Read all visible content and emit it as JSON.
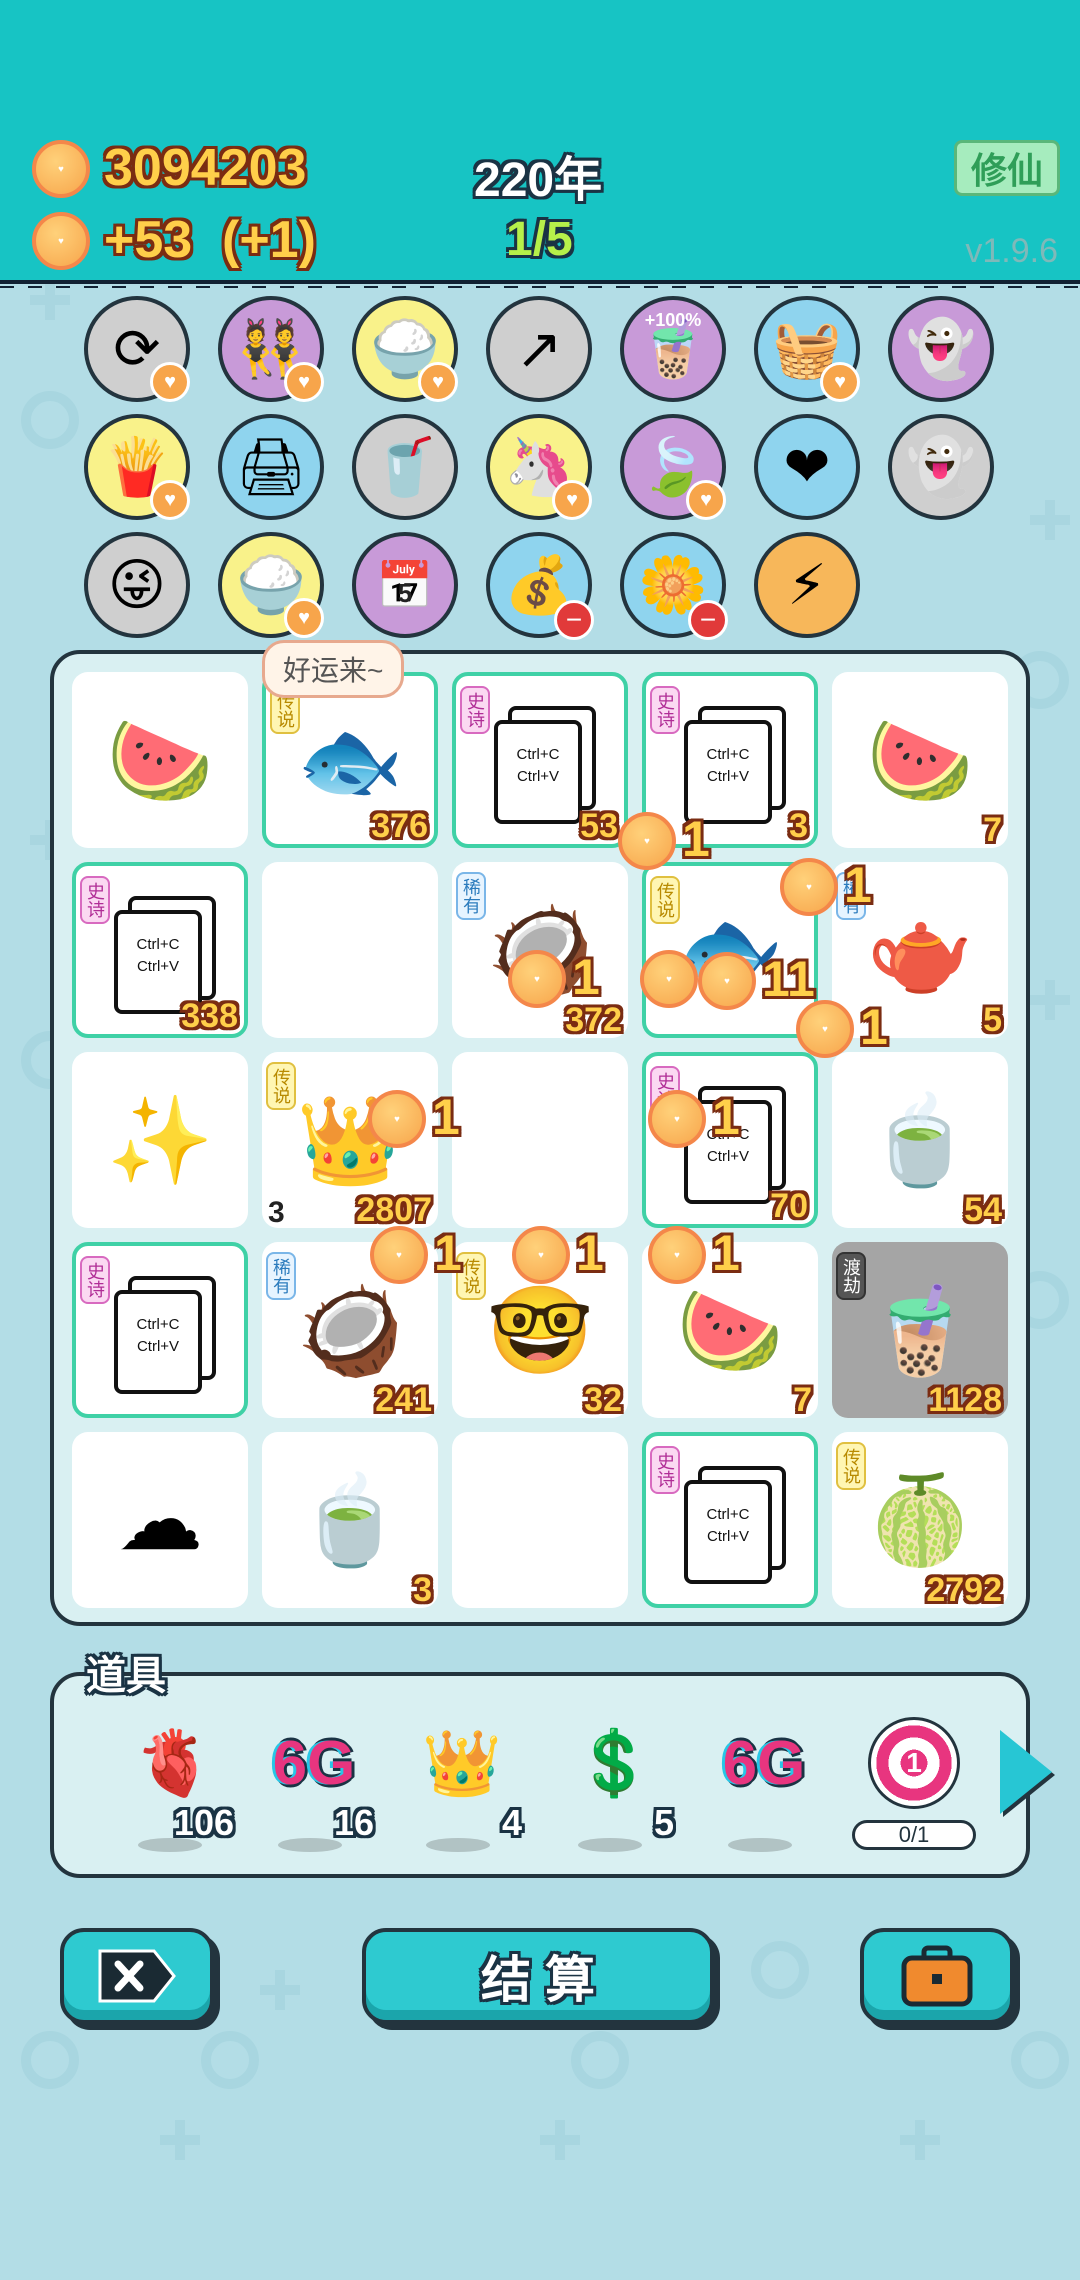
{
  "header": {
    "coins": "3094203",
    "income": "+53",
    "income_bonus": "(+1)",
    "year": "220年",
    "progress": "1/5",
    "cultivate_label": "修仙",
    "version": "v1.9.6"
  },
  "skills": [
    {
      "icon": "refresh-icon",
      "color": "#cfcfcf"
    },
    {
      "icon": "cow-girls-icon",
      "color": "#c89ad8"
    },
    {
      "icon": "rice-bowl-icon",
      "color": "#f9f28a"
    },
    {
      "icon": "upgrade-arrow-icon",
      "color": "#cfcfcf"
    },
    {
      "icon": "milk-tea-icon",
      "color": "#c89ad8",
      "percent": "+100%"
    },
    {
      "icon": "fruit-basket-icon",
      "color": "#8fd4ee"
    },
    {
      "icon": "ghost-bomb-icon",
      "color": "#c89ad8"
    },
    {
      "icon": "fries-icon",
      "color": "#f9f28a"
    },
    {
      "icon": "printer-icon",
      "color": "#8fd4ee"
    },
    {
      "icon": "milk-tea-cup-icon",
      "color": "#cfcfcf"
    },
    {
      "icon": "unicorn-icon",
      "color": "#f9f28a"
    },
    {
      "icon": "leaf-icon",
      "color": "#c89ad8"
    },
    {
      "icon": "heart-cup-icon",
      "color": "#8fd4ee"
    },
    {
      "icon": "ghost-icon",
      "color": "#cfcfcf"
    },
    {
      "icon": "ghost-wink-icon",
      "color": "#cfcfcf"
    },
    {
      "icon": "rice-bowl-icon",
      "color": "#f9f28a"
    },
    {
      "icon": "calendar-icon",
      "color": "#c89ad8",
      "day": "5"
    },
    {
      "icon": "money-bag-icon",
      "color": "#8fd4ee"
    },
    {
      "icon": "flower-pot-icon",
      "color": "#8fd4ee"
    },
    {
      "icon": "lightning-icon",
      "color": "#f7b75a"
    }
  ],
  "board": {
    "bubble": "好运来~",
    "cells": [
      {
        "icon": "watermelon-slice-icon",
        "count": ""
      },
      {
        "icon": "koi-fish-icon",
        "count": "376",
        "tag": "传说",
        "tag_type": "legend",
        "framed": true
      },
      {
        "icon": "copy-paste-icon",
        "count": "53",
        "tag": "史诗",
        "tag_type": "epic",
        "framed": true
      },
      {
        "icon": "copy-paste-icon",
        "count": "3",
        "tag": "史诗",
        "tag_type": "epic",
        "framed": true
      },
      {
        "icon": "watermelon-slice-icon",
        "count": "7"
      },
      {
        "icon": "copy-paste-icon",
        "count": "338",
        "tag": "史诗",
        "tag_type": "epic",
        "framed": true
      },
      {
        "icon": "empty",
        "count": ""
      },
      {
        "icon": "coconut-icon",
        "count": "372",
        "tag": "稀有",
        "tag_type": "rare"
      },
      {
        "icon": "koi-fish-icon",
        "count": "",
        "tag": "传说",
        "tag_type": "legend",
        "framed": true
      },
      {
        "icon": "teapot-icon",
        "count": "5",
        "tag": "稀有",
        "tag_type": "rare"
      },
      {
        "icon": "sparkles-icon",
        "count": ""
      },
      {
        "icon": "crown-fruit-icon",
        "count": "2807",
        "left_count": "3",
        "tag": "传说",
        "tag_type": "legend"
      },
      {
        "icon": "empty",
        "count": ""
      },
      {
        "icon": "copy-paste-icon",
        "count": "70",
        "tag": "史诗",
        "tag_type": "epic",
        "framed": true
      },
      {
        "icon": "tea-bowl-icon",
        "count": "54"
      },
      {
        "icon": "copy-paste-icon",
        "count": "",
        "tag": "史诗",
        "tag_type": "epic",
        "framed": true
      },
      {
        "icon": "coconut-icon",
        "count": "241",
        "tag": "稀有",
        "tag_type": "rare"
      },
      {
        "icon": "king-face-icon",
        "count": "32",
        "tag": "传说",
        "tag_type": "legend"
      },
      {
        "icon": "watermelon-slice-icon",
        "count": "7"
      },
      {
        "icon": "milk-tea-icon",
        "count": "1128",
        "tag": "渡劫",
        "tag_type": "dujie",
        "gray": true
      },
      {
        "icon": "rice-icon",
        "count": ""
      },
      {
        "icon": "tea-bowl-icon",
        "count": "3"
      },
      {
        "icon": "empty",
        "count": ""
      },
      {
        "icon": "copy-paste-icon",
        "count": "",
        "tag": "史诗",
        "tag_type": "epic",
        "framed": true
      },
      {
        "icon": "watermelon-icon",
        "count": "2792",
        "tag": "传说",
        "tag_type": "legend"
      }
    ],
    "copy_text_1": "Ctrl+C",
    "copy_text_2": "Ctrl+V",
    "floaters": [
      "1",
      "1",
      "1",
      "1",
      "1",
      "1",
      "1",
      "1",
      "1",
      "1",
      "11"
    ]
  },
  "tools": {
    "label": "道具",
    "items": [
      {
        "icon": "liver-icon",
        "count": "106"
      },
      {
        "icon": "6g-icon",
        "text": "6G",
        "count": "16"
      },
      {
        "icon": "crown-icon",
        "count": "4"
      },
      {
        "icon": "dollar-coin-icon",
        "count": "5"
      },
      {
        "icon": "6g-icon",
        "text": "6G",
        "count": ""
      },
      {
        "icon": "target-icon",
        "text": "1",
        "progress": "0/1"
      }
    ]
  },
  "bottom": {
    "settle_label": "结 算"
  }
}
